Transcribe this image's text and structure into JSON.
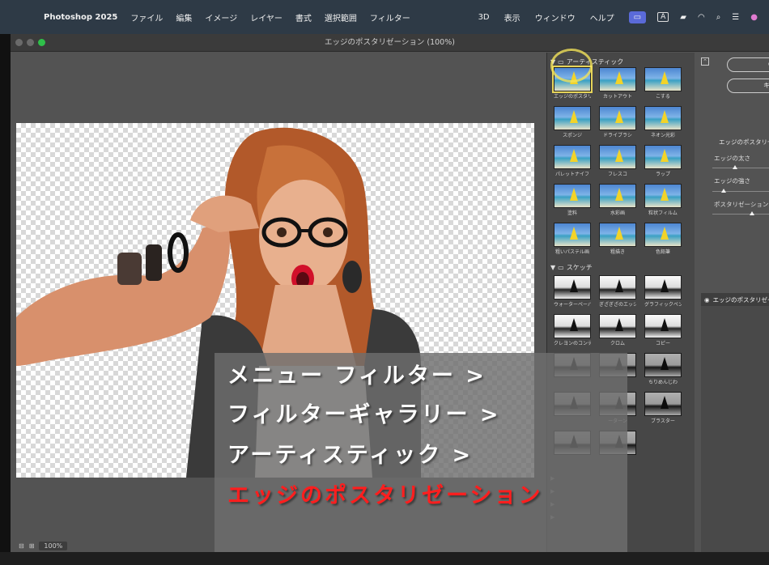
{
  "menubar": {
    "app_name": "Photoshop 2025",
    "items": [
      "ファイル",
      "編集",
      "イメージ",
      "レイヤー",
      "書式",
      "選択範囲",
      "フィルター"
    ],
    "right_items": [
      "3D",
      "表示",
      "ウィンドウ",
      "ヘルプ"
    ],
    "status_icons": [
      "screen-icon",
      "text-input-icon",
      "battery-icon",
      "wifi-icon",
      "search-icon",
      "control-center-icon",
      "siri-icon"
    ],
    "input_label": "A"
  },
  "window": {
    "title": "エッジのポスタリゼーション (100%)"
  },
  "gallery": {
    "artistic_folder": "アーティスティック",
    "artistic": [
      "エッジのポスタリゼーション",
      "カットアウト",
      "こする",
      "スポンジ",
      "ドライブラシ",
      "ネオン光彩",
      "パレットナイフ",
      "フレスコ",
      "ラップ",
      "塗料",
      "水彩画",
      "粒状フィルム",
      "粗いパステル画",
      "粗描き",
      "色鉛筆"
    ],
    "sketch_folder": "スケッチ",
    "sketch": [
      "ウォーターペーパー",
      "ぎざぎざのエッジ",
      "グラフィックペン",
      "クレヨンのコンテ画",
      "クロム",
      "コピー",
      "",
      "",
      "ちりめんじわ",
      "",
      "ーターン",
      "ブラスター",
      "",
      ""
    ]
  },
  "settings": {
    "ok_label": "O",
    "cancel_label": "キャ",
    "filter_title": "エッジのポスタリゼー",
    "params": [
      {
        "label": "エッジの太さ",
        "value": 0.4
      },
      {
        "label": "エッジの強さ",
        "value": 0.2
      },
      {
        "label": "ポスタリゼーション",
        "value": 0.7
      }
    ],
    "layer_name": "エッジのポスタリゼー"
  },
  "zoom": "100%",
  "caption": {
    "line1": "メニュー フィルター >",
    "line2": "フィルターギャラリー >",
    "line3": "アーティスティック >",
    "line4": "エッジのポスタリゼーション"
  },
  "colors": {
    "accent": "#ff1e1e",
    "selection_ring": "#f2e25a"
  }
}
